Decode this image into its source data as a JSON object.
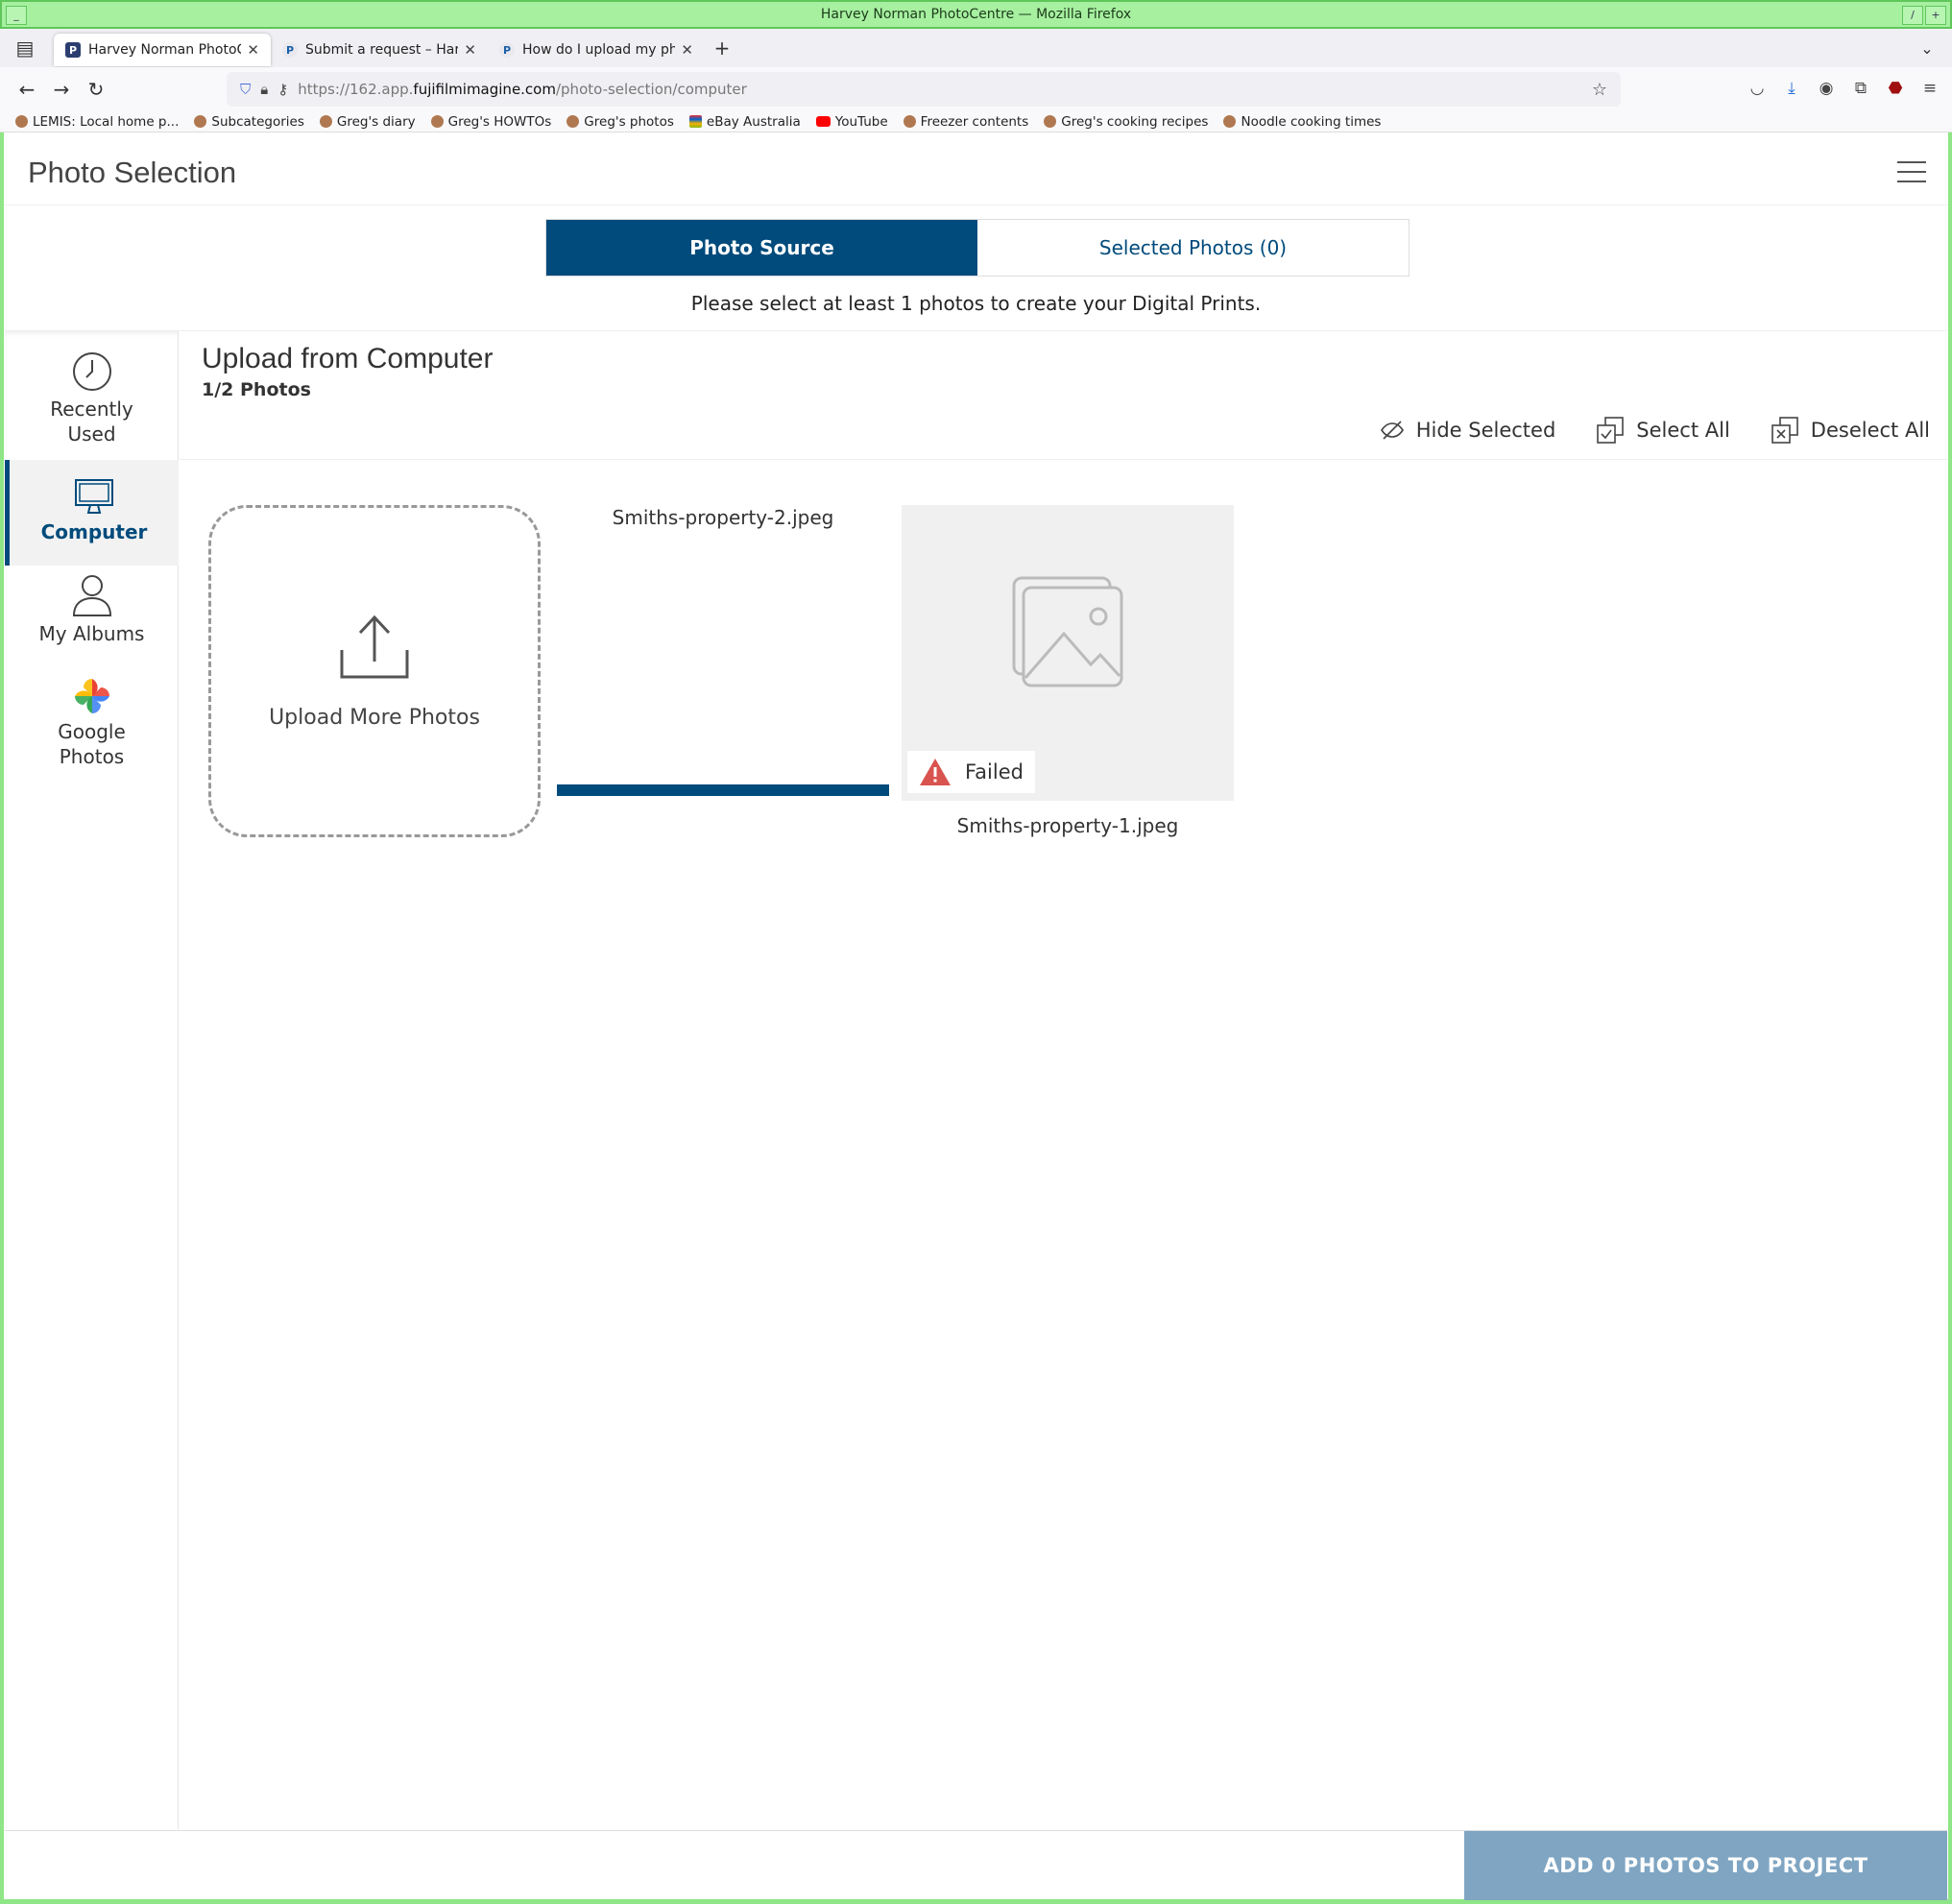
{
  "window": {
    "title": "Harvey Norman PhotoCentre — Mozilla Firefox"
  },
  "tabs": [
    {
      "label": "Harvey Norman PhotoCentre",
      "active": true
    },
    {
      "label": "Submit a request – Harvey Norman",
      "active": false
    },
    {
      "label": "How do I upload my photos",
      "active": false
    }
  ],
  "address": {
    "prefix": "https://162.app.",
    "domain": "fujifilmimagine.com",
    "path": "/photo-selection/computer"
  },
  "bookmarks": [
    "LEMIS: Local home p...",
    "Subcategories",
    "Greg's diary",
    "Greg's HOWTOs",
    "Greg's photos",
    "eBay Australia",
    "YouTube",
    "Freezer contents",
    "Greg's cooking recipes",
    "Noodle cooking times"
  ],
  "page": {
    "title": "Photo Selection",
    "segment": {
      "source": "Photo Source",
      "selected": "Selected Photos (0)"
    },
    "prompt": "Please select at least 1 photos to create your Digital Prints."
  },
  "sidebar": {
    "recent": {
      "line1": "Recently",
      "line2": "Used"
    },
    "computer": "Computer",
    "albums": "My Albums",
    "google": {
      "line1": "Google",
      "line2": "Photos"
    }
  },
  "content": {
    "title": "Upload from Computer",
    "count": "1/2 Photos",
    "actions": {
      "hide": "Hide Selected",
      "select_all": "Select All",
      "deselect_all": "Deselect All"
    },
    "upload_label": "Upload More Photos",
    "files": [
      {
        "name": "Smiths-property-2.jpeg",
        "progress": 1.0
      },
      {
        "name": "Smiths-property-1.jpeg",
        "status": "Failed"
      }
    ]
  },
  "footer": {
    "add_button": "ADD 0 PHOTOS TO PROJECT"
  },
  "colors": {
    "brand": "#004b7c",
    "disabled_button": "#7fa5c2",
    "error": "#d9534f"
  }
}
